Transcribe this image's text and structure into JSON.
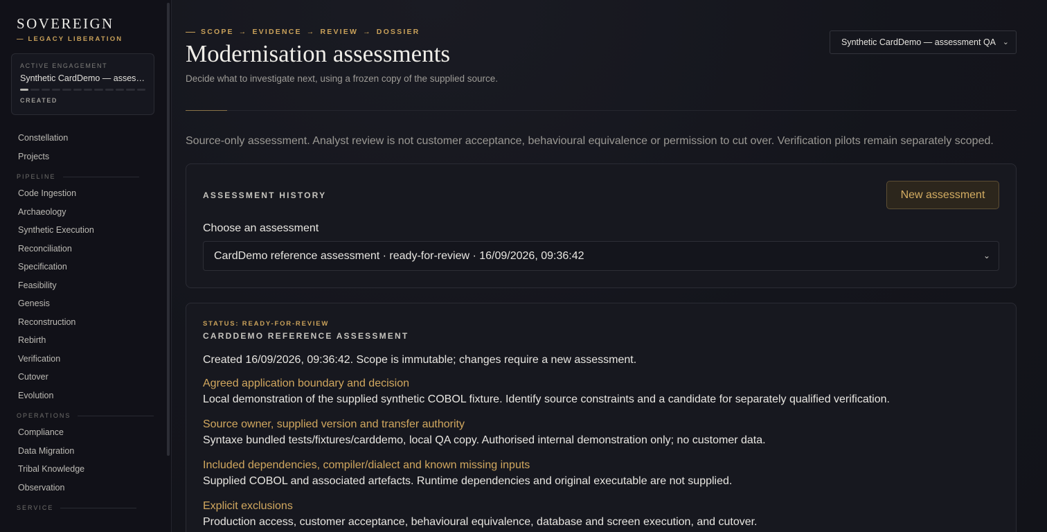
{
  "brand": {
    "name": "SOVEREIGN",
    "subtitle": "— LEGACY LIBERATION"
  },
  "engagement": {
    "label": "ACTIVE ENGAGEMENT",
    "name": "Synthetic CardDemo — assessment QA",
    "status": "CREATED",
    "progress_steps_total": 12,
    "progress_steps_done": 1
  },
  "nav": {
    "top": [
      "Constellation",
      "Projects"
    ],
    "pipeline_label": "PIPELINE",
    "pipeline": [
      "Code Ingestion",
      "Archaeology",
      "Synthetic Execution",
      "Reconciliation",
      "Specification",
      "Feasibility",
      "Genesis",
      "Reconstruction",
      "Rebirth",
      "Verification",
      "Cutover",
      "Evolution"
    ],
    "operations_label": "OPERATIONS",
    "operations": [
      "Compliance",
      "Data Migration",
      "Tribal Knowledge",
      "Observation"
    ],
    "service_label": "SERVICE"
  },
  "header": {
    "crumbs": [
      "SCOPE",
      "EVIDENCE",
      "REVIEW",
      "DOSSIER"
    ],
    "title": "Modernisation assessments",
    "subtitle": "Decide what to investigate next, using a frozen copy of the supplied source.",
    "engagement_select": "Synthetic CardDemo — assessment QA"
  },
  "notice": "Source-only assessment. Analyst review is not customer acceptance, behavioural equivalence or permission to cut over. Verification pilots remain separately scoped.",
  "history": {
    "heading": "ASSESSMENT HISTORY",
    "new_button": "New assessment",
    "choose_label": "Choose an assessment",
    "selected": "CardDemo reference assessment · ready-for-review · 16/09/2026, 09:36:42"
  },
  "detail": {
    "status": "STATUS: READY-FOR-REVIEW",
    "title": "CARDDEMO REFERENCE ASSESSMENT",
    "created": "Created 16/09/2026, 09:36:42. Scope is immutable; changes require a new assessment.",
    "fields": [
      {
        "title": "Agreed application boundary and decision",
        "value": "Local demonstration of the supplied synthetic COBOL fixture. Identify source constraints and a candidate for separately qualified verification."
      },
      {
        "title": "Source owner, supplied version and transfer authority",
        "value": "Syntaxe bundled tests/fixtures/carddemo, local QA copy. Authorised internal demonstration only; no customer data."
      },
      {
        "title": "Included dependencies, compiler/dialect and known missing inputs",
        "value": "Supplied COBOL and associated artefacts. Runtime dependencies and original executable are not supplied."
      },
      {
        "title": "Explicit exclusions",
        "value": "Production access, customer acceptance, behavioural equivalence, database and screen execution, and cutover."
      }
    ]
  },
  "colors": {
    "accent": "#c9a15a",
    "background": "#13141b",
    "sidebar": "#111118"
  }
}
